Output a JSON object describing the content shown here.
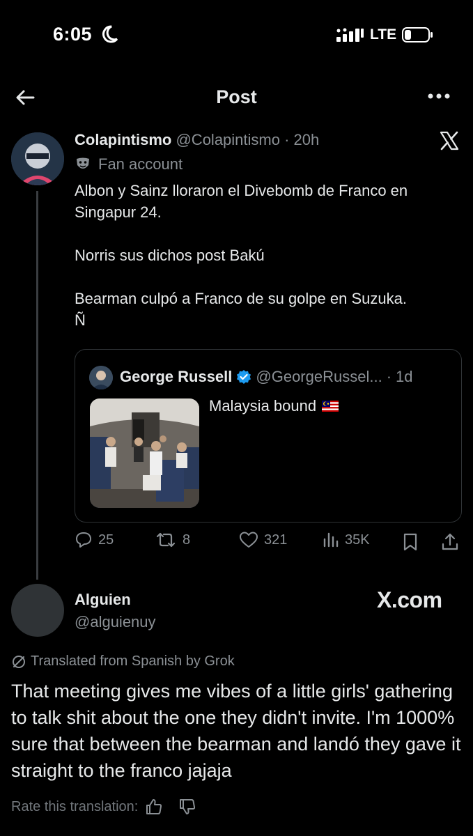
{
  "status_bar": {
    "time": "6:05",
    "network": "LTE"
  },
  "header": {
    "title": "Post"
  },
  "post": {
    "author_name": "Colapintismo",
    "author_handle": "@Colapintismo",
    "separator": "·",
    "time": "20h",
    "account_label": "Fan account",
    "text_lines": [
      "Albon y Sainz lloraron el Divebomb de Franco en",
      "Singapur 24.",
      "Norris sus dichos post Bakú",
      "Bearman culpó a Franco de su golpe en Suzuka.",
      "Ñ"
    ],
    "quote": {
      "author_name": "George Russell",
      "author_handle": "@GeorgeRussel...",
      "separator": "·",
      "time": "1d",
      "text": "Malaysia bound",
      "flag": "Malaysia flag"
    },
    "actions": {
      "replies": "25",
      "reposts": "8",
      "likes": "321",
      "views": "35K"
    }
  },
  "reply": {
    "author_name": "Alguien",
    "author_handle": "@alguienuy",
    "site_label": "X.com",
    "translated_label": "Translated from Spanish by Grok",
    "translation_text": "That meeting gives me vibes of a little girls' gathering to talk shit about the one they didn't invite. I'm 1000% sure that between the bearman and landó they gave it straight to the franco jajaja",
    "rate_label": "Rate this translation:"
  },
  "colors": {
    "background": "#000000",
    "text_primary": "#e7e9ea",
    "text_secondary": "#8b9095",
    "border": "#2f3336",
    "verified": "#1d9bf0"
  }
}
